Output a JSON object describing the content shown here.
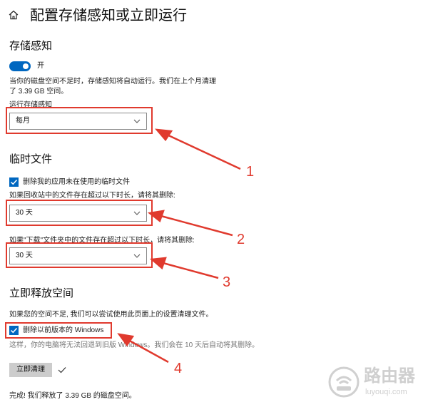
{
  "header": {
    "title": "配置存储感知或立即运行",
    "home_icon": "home-icon"
  },
  "storage_sense": {
    "heading": "存储感知",
    "toggle_state": "开",
    "description_line1": "当你的磁盘空间不足时，存储感知将自动运行。我们在上个月清理",
    "description_line2": "了 3.39 GB 空间。",
    "run_label": "运行存储感知",
    "run_value": "每月"
  },
  "temp_files": {
    "heading": "临时文件",
    "delete_temp_label": "删除我的应用未在使用的临时文件",
    "recycle_label": "如果回收站中的文件存在超过以下时长，请将其删除:",
    "recycle_value": "30 天",
    "downloads_label": "如果\"下载\"文件夹中的文件存在超过以下时长，请将其删除:",
    "downloads_value": "30 天"
  },
  "free_space": {
    "heading": "立即释放空间",
    "description": "如果您的空间不足, 我们可以尝试使用此页面上的设置清理文件。",
    "delete_previous_label": "删除以前版本的 Windows",
    "delete_previous_note": "这样，你的电脑将无法回退到旧版 Windows。我们会在 10 天后自动将其删除。",
    "clean_button": "立即清理",
    "status": "完成! 我们释放了 3.39 GB 的磁盘空间。"
  },
  "annotations": [
    "1",
    "2",
    "3",
    "4"
  ],
  "watermark": {
    "title": "路由器",
    "url": "luyouqi.com"
  },
  "colors": {
    "accent": "#0067c0",
    "annotation_red": "#e03a2e",
    "button_gray": "#cccccc"
  }
}
